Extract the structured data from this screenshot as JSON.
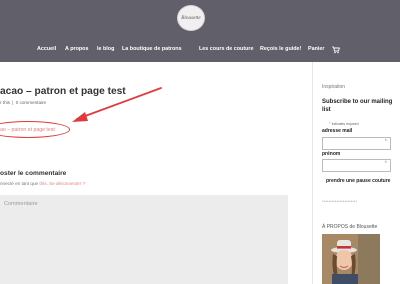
{
  "header": {
    "logo_text": "Blousette",
    "nav": [
      "Accueil",
      "A propos",
      "le blog",
      "La boutique de patrons",
      "Les cours de couture",
      "Reçois le guide!",
      "Panier"
    ],
    "cart_icon": "cart-icon"
  },
  "post": {
    "title": "acao – patron et page test",
    "meta_author": "r this",
    "meta_sep": "|",
    "meta_comments": "0 commentaire",
    "link_text": "ao – patron et page test"
  },
  "comment": {
    "title": "oster le commentaire",
    "logged_in_prefix": "nnecté en tant que",
    "user_link": "this",
    "logout_link": "Se déconnecter ?",
    "placeholder": "Commentaire"
  },
  "sidebar": {
    "inspiration": "Inspiration",
    "subscribe_title": "Subscribe to our mailing list",
    "required_mark": "*",
    "required_text": "indicates required",
    "email_label": "adresse mail",
    "prenom_label": "prénom",
    "field_mark": "*",
    "submit_label": "prendre une pause couture",
    "stars": "**********************",
    "about_title": "À PROPOS de Blousette"
  },
  "colors": {
    "header_bg": "#615f6a",
    "link": "#e67e7e",
    "annotation": "#e23a3a",
    "required": "#e38a3c"
  }
}
